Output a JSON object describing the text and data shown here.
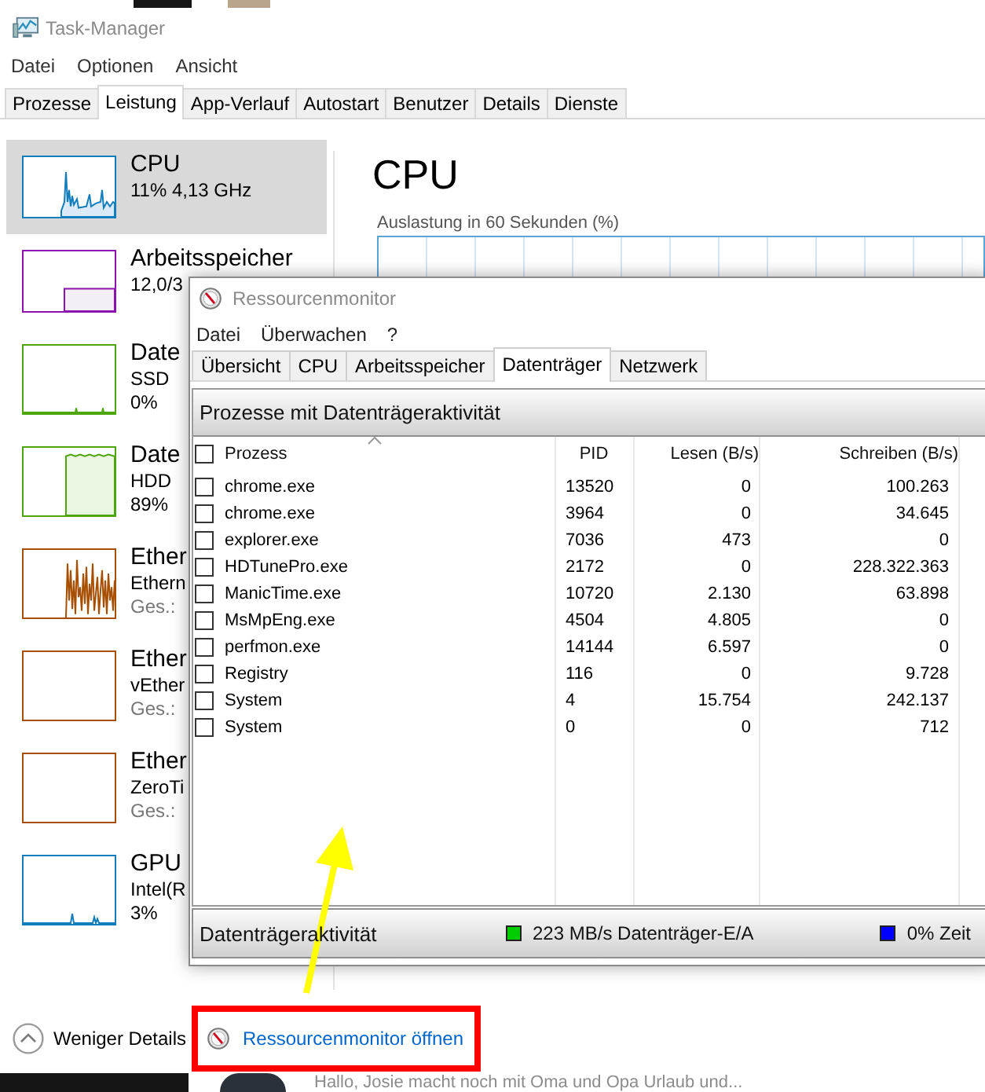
{
  "task_manager": {
    "window": {
      "title": "Task-Manager"
    },
    "menu": [
      "Datei",
      "Optionen",
      "Ansicht"
    ],
    "tabs": [
      {
        "label": "Prozesse",
        "selected": false
      },
      {
        "label": "Leistung",
        "selected": true
      },
      {
        "label": "App-Verlauf",
        "selected": false
      },
      {
        "label": "Autostart",
        "selected": false
      },
      {
        "label": "Benutzer",
        "selected": false
      },
      {
        "label": "Details",
        "selected": false
      },
      {
        "label": "Dienste",
        "selected": false
      }
    ],
    "sidebar": {
      "items": [
        {
          "title": "CPU",
          "lines": [
            "11% 4,13 GHz"
          ],
          "color": "#117dbb",
          "selected": true
        },
        {
          "title": "Arbeitsspeicher",
          "lines": [
            "12,0/3"
          ],
          "color": "#8b12ae",
          "selected": false
        },
        {
          "title": "Date",
          "lines": [
            "SSD",
            "0%"
          ],
          "color": "#4da60c",
          "selected": false
        },
        {
          "title": "Date",
          "lines": [
            "HDD",
            "89%"
          ],
          "color": "#4da60c",
          "selected": false
        },
        {
          "title": "Ether",
          "lines": [
            "Ethern"
          ],
          "note": "Ges.:",
          "color": "#a74f01",
          "selected": false
        },
        {
          "title": "Ether",
          "lines": [
            "vEther"
          ],
          "note": "Ges.:",
          "color": "#a74f01",
          "selected": false
        },
        {
          "title": "Ether",
          "lines": [
            "ZeroTi"
          ],
          "note": "Ges.:",
          "color": "#a74f01",
          "selected": false
        },
        {
          "title": "GPU",
          "lines": [
            "Intel(R",
            "3%"
          ],
          "color": "#117dbb",
          "selected": false
        }
      ]
    },
    "main": {
      "title": "CPU",
      "chart_caption": "Auslastung in 60 Sekunden (%)"
    },
    "footer": {
      "toggle": "Weniger Details",
      "link": "Ressourcenmonitor öffnen",
      "link_highlighted": true
    }
  },
  "resource_monitor": {
    "window": {
      "title": "Ressourcenmonitor"
    },
    "menu": [
      "Datei",
      "Überwachen",
      "?"
    ],
    "tabs": [
      {
        "label": "Übersicht",
        "selected": false
      },
      {
        "label": "CPU",
        "selected": false
      },
      {
        "label": "Arbeitsspeicher",
        "selected": false
      },
      {
        "label": "Datenträger",
        "selected": true
      },
      {
        "label": "Netzwerk",
        "selected": false
      }
    ],
    "process_panel": {
      "title": "Prozesse mit Datenträgeraktivität",
      "columns": [
        "Prozess",
        "PID",
        "Lesen (B/s)",
        "Schreiben (B/s)"
      ],
      "all_checked": false,
      "rows": [
        {
          "process": "chrome.exe",
          "pid": "13520",
          "read": "0",
          "write": "100.263",
          "checked": false
        },
        {
          "process": "chrome.exe",
          "pid": "3964",
          "read": "0",
          "write": "34.645",
          "checked": false
        },
        {
          "process": "explorer.exe",
          "pid": "7036",
          "read": "473",
          "write": "0",
          "checked": false
        },
        {
          "process": "HDTunePro.exe",
          "pid": "2172",
          "read": "0",
          "write": "228.322.363",
          "checked": false
        },
        {
          "process": "ManicTime.exe",
          "pid": "10720",
          "read": "2.130",
          "write": "63.898",
          "checked": false
        },
        {
          "process": "MsMpEng.exe",
          "pid": "4504",
          "read": "4.805",
          "write": "0",
          "checked": false
        },
        {
          "process": "perfmon.exe",
          "pid": "14144",
          "read": "6.597",
          "write": "0",
          "checked": false
        },
        {
          "process": "Registry",
          "pid": "116",
          "read": "0",
          "write": "9.728",
          "checked": false
        },
        {
          "process": "System",
          "pid": "4",
          "read": "15.754",
          "write": "242.137",
          "checked": false
        },
        {
          "process": "System",
          "pid": "0",
          "read": "0",
          "write": "712",
          "checked": false
        }
      ]
    },
    "activity_panel": {
      "title": "Datenträgeraktivität",
      "legend": [
        {
          "label": "223 MB/s Datenträger-E/A",
          "color": "#00cc00"
        },
        {
          "label": "0% Zeit",
          "color": "#0000ff"
        }
      ]
    }
  },
  "annotations": [
    {
      "kind": "arrow"
    }
  ],
  "background_message": {
    "text": "Hallo, Josie macht noch mit Oma und Opa Urlaub und..."
  }
}
